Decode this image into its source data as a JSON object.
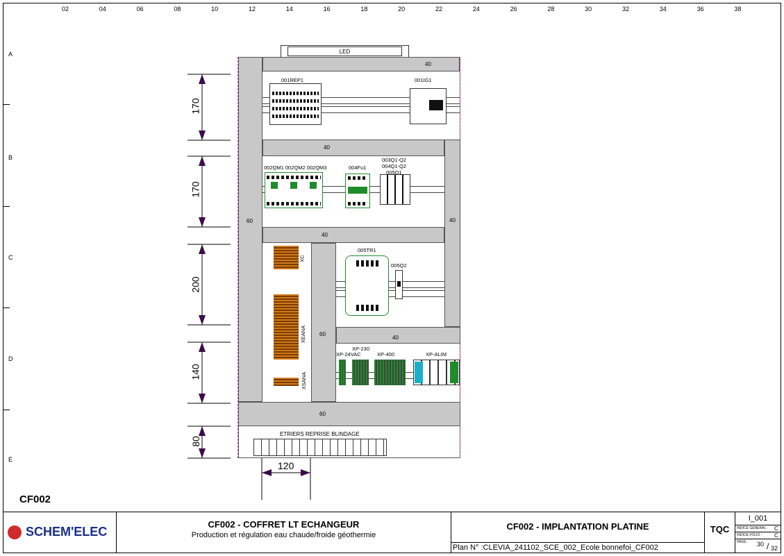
{
  "grid": {
    "columns": [
      "02",
      "04",
      "06",
      "08",
      "10",
      "12",
      "14",
      "16",
      "18",
      "20",
      "22",
      "24",
      "26",
      "28",
      "30",
      "32",
      "34",
      "36",
      "38"
    ],
    "rows": [
      "A",
      "B",
      "C",
      "D",
      "E"
    ]
  },
  "dimensions": {
    "v1": "170",
    "v2": "170",
    "v3": "200",
    "v4": "140",
    "v5": "80",
    "h1": "120"
  },
  "panel": {
    "led": "LED",
    "ducts": {
      "top": "40",
      "d2": "40",
      "d3": "40",
      "d4": "40",
      "bottom": "60",
      "left": "60",
      "right": "40",
      "mid": "60"
    },
    "components": {
      "rep1": "001REP1",
      "ig1": "001IG1",
      "qm": "002QM1 002QM2 002QM3",
      "fu": "004Fu1",
      "q1": "003Q1-Q2",
      "q2": "004Q1-Q2",
      "q3": "005Q1",
      "tr1": "005TR1",
      "q52": "005Q2",
      "xc": "XC",
      "xeana": "XEANA",
      "xsana": "XSANA",
      "xp230": "XP-230",
      "xp24": "XP-24VAC",
      "xp400": "XP-400",
      "xpalim": "XP-ALIM",
      "etriers": "ETRIERS REPRISE BLINDAGE"
    }
  },
  "cabinet_id": "CF002",
  "title_block": {
    "logo": "SCHEM'ELEC",
    "title": "CF002 - COFFRET LT ECHANGEUR",
    "subtitle": "Production et régulation eau chaude/froide géothermie",
    "sheet_title": "CF002 - IMPLANTATION PLATINE",
    "plan": "Plan N° :CLEVIA_241102_SCE_002_Ecole bonnefoi_CF002",
    "company": "TQC",
    "index": "I_001",
    "indice_general_label": "INDICE GENERAL :",
    "indice_general": "C",
    "indice_folio_label": "INDICE FOLIO :",
    "indice_folio": "C",
    "page_label": "PAGE :",
    "page": "30",
    "pages": "32"
  },
  "colors": {
    "duct": "#c8c8c8",
    "terminal_green": "#1e8c2a",
    "terminal_orange": "#d27a1a",
    "logo_red": "#d12a2a"
  }
}
